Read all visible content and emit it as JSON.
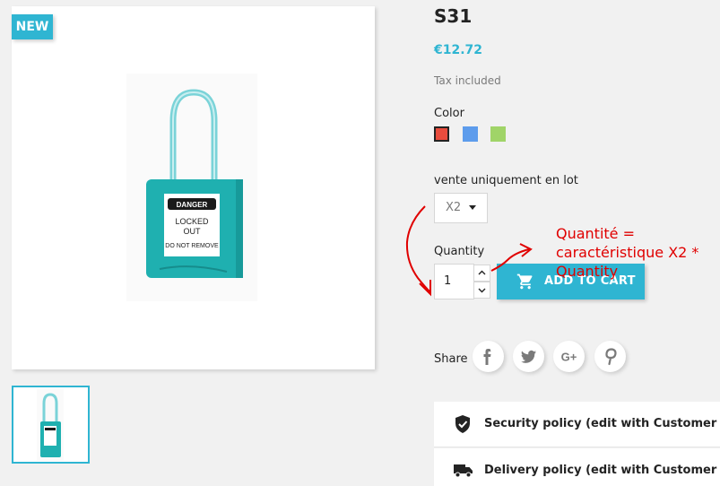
{
  "product": {
    "badge": "NEW",
    "title": "S31",
    "price": "€12.72",
    "tax_note": "Tax included",
    "image_label": {
      "line1": "DANGER",
      "line2": "LOCKED",
      "line3": "OUT",
      "line4": "DO NOT REMOVE"
    }
  },
  "variants": {
    "color_label": "Color",
    "colors": [
      {
        "name": "Red",
        "hex": "#e84c3d",
        "selected": true
      },
      {
        "name": "Blue",
        "hex": "#5d9cec",
        "selected": false
      },
      {
        "name": "Green",
        "hex": "#a0d468",
        "selected": false
      }
    ],
    "lot_label": "vente uniquement en lot",
    "lot_value": "X2"
  },
  "quantity": {
    "label": "Quantity",
    "value": "1"
  },
  "cart": {
    "add_label": "ADD TO CART"
  },
  "share": {
    "label": "Share",
    "networks": [
      "facebook-icon",
      "twitter-icon",
      "google-plus-icon",
      "pinterest-icon"
    ]
  },
  "policies": [
    {
      "icon": "shield-check-icon",
      "text": "Security policy (edit with Customer reass"
    },
    {
      "icon": "truck-icon",
      "text": "Delivery policy (edit with Customer reass"
    }
  ],
  "annotation": {
    "line1": "Quantité =",
    "line2": "caractéristique X2 *",
    "line3": "Quantity"
  },
  "colors": {
    "accent": "#2fb5d2",
    "annotation": "#e00000"
  }
}
